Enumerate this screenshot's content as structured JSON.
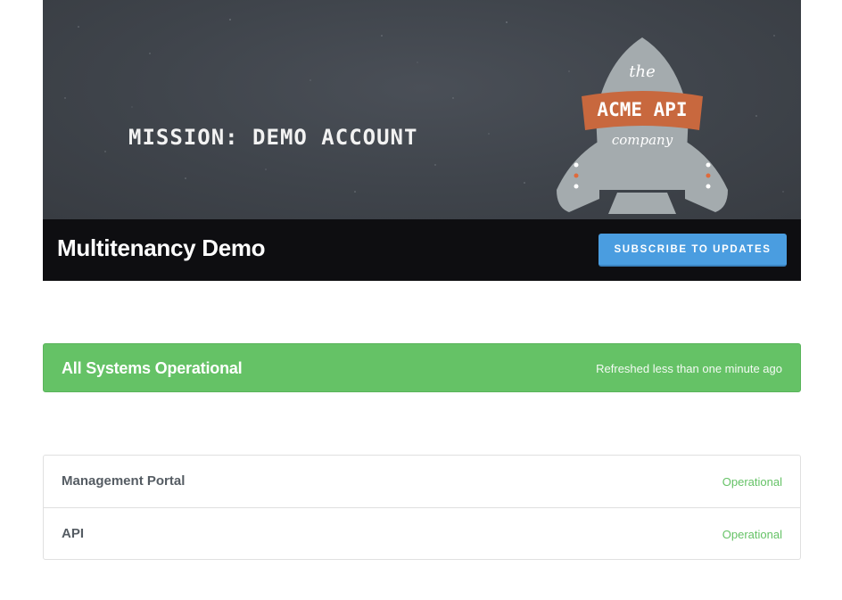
{
  "hero": {
    "mission_text": "MISSION: DEMO ACCOUNT",
    "logo": {
      "top_text": "the",
      "banner_text": "ACME API",
      "bottom_text": "company"
    },
    "page_name": "Multitenancy Demo",
    "subscribe_label": "SUBSCRIBE TO UPDATES"
  },
  "status": {
    "title": "All Systems Operational",
    "refreshed": "Refreshed less than one minute ago"
  },
  "components": [
    {
      "name": "Management Portal",
      "status": "Operational"
    },
    {
      "name": "API",
      "status": "Operational"
    }
  ],
  "colors": {
    "operational_green": "#65c266",
    "subscribe_blue": "#4a9de0",
    "rocket_gray": "#a4abae",
    "banner_orange": "#c8683e",
    "hero_bg": "#3e434a"
  },
  "icons": {
    "logo": "rocket-logo-icon"
  }
}
